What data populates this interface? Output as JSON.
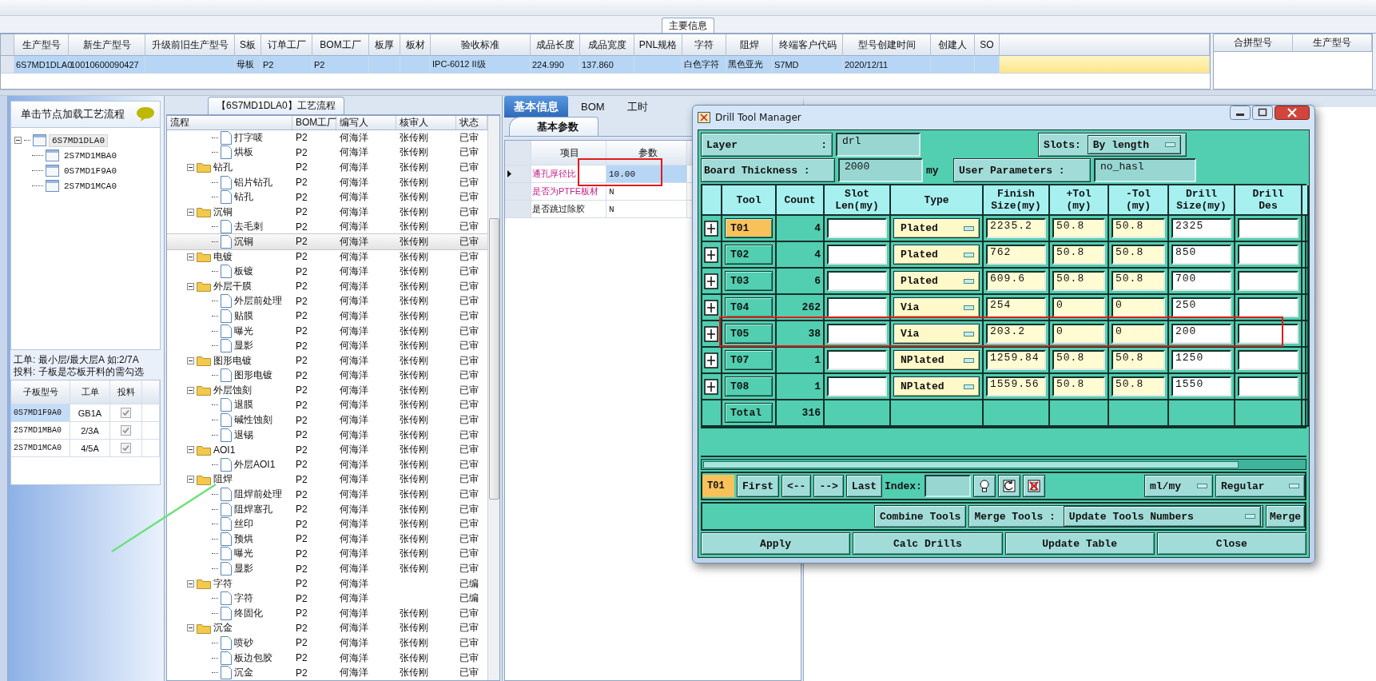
{
  "main_info": {
    "title": "主要信息",
    "columns": [
      "生产型号",
      "新生产型号",
      "升级前旧生产型号",
      "S板",
      "订单工厂",
      "BOM工厂",
      "板厚",
      "板材",
      "验收标准",
      "成品长度",
      "成品宽度",
      "PNL规格",
      "字符",
      "阻焊",
      "终端客户代码",
      "型号创建时间",
      "创建人",
      "SO"
    ],
    "rows": [
      {
        "selected": true,
        "cells": [
          "6S7MD1DLA0",
          "10010600090427",
          "",
          "母板",
          "P2",
          "P2",
          "",
          "",
          "IPC-6012 II级",
          "224.990",
          "137.860",
          "",
          "白色字符",
          "黑色亚光",
          "S7MD",
          "2020/12/11",
          "",
          ""
        ]
      }
    ]
  },
  "merge_table": {
    "columns": [
      "合拼型号",
      "生产型号"
    ]
  },
  "node_panel": {
    "title": "单击节点加载工艺流程",
    "tree": [
      {
        "label": "6S7MD1DLA0",
        "selected": true,
        "expanded": true,
        "children": [
          {
            "label": "2S7MD1MBA0",
            "selected": false
          },
          {
            "label": "0S7MD1F9A0",
            "selected": false
          },
          {
            "label": "2S7MD1MCA0",
            "selected": false
          }
        ]
      }
    ],
    "notes": [
      "工单: 最小层/最大层A 如:2/7A",
      "投料: 子板是芯板开料的需勾选"
    ],
    "sub_boards": {
      "columns": [
        "子板型号",
        "工单",
        "投料"
      ],
      "rows": [
        {
          "model": "0S7MD1F9A0",
          "order": "GB1A",
          "checked": true,
          "selected": true
        },
        {
          "model": "2S7MD1MBA0",
          "order": "2/3A",
          "checked": true,
          "selected": false
        },
        {
          "model": "2S7MD1MCA0",
          "order": "4/5A",
          "checked": true,
          "selected": false
        }
      ]
    }
  },
  "process_flow": {
    "title": "【6S7MD1DLA0】工艺流程",
    "columns": [
      "流程",
      "BOM工厂",
      "编写人",
      "核审人",
      "状态"
    ],
    "steps": [
      {
        "children": [
          {
            "name": "打字唛",
            "bom": "P2",
            "author": "何海洋",
            "reviewer": "张传刚",
            "status": "已审",
            "selected": false
          },
          {
            "name": "烘板",
            "bom": "P2",
            "author": "何海洋",
            "reviewer": "张传刚",
            "status": "已审",
            "selected": false
          }
        ]
      },
      {
        "name": "钻孔",
        "bom": "P2",
        "author": "何海洋",
        "reviewer": "张传刚",
        "status": "已审",
        "selected": false,
        "expanded": true,
        "children": [
          {
            "name": "铝片钻孔",
            "bom": "P2",
            "author": "何海洋",
            "reviewer": "张传刚",
            "status": "已审",
            "selected": false
          },
          {
            "name": "钻孔",
            "bom": "P2",
            "author": "何海洋",
            "reviewer": "张传刚",
            "status": "已审",
            "selected": false
          }
        ]
      },
      {
        "name": "沉铜",
        "bom": "P2",
        "author": "何海洋",
        "reviewer": "张传刚",
        "status": "已审",
        "selected": false,
        "expanded": true,
        "children": [
          {
            "name": "去毛刺",
            "bom": "P2",
            "author": "何海洋",
            "reviewer": "张传刚",
            "status": "已审",
            "selected": false
          },
          {
            "name": "沉铜",
            "bom": "P2",
            "author": "何海洋",
            "reviewer": "张传刚",
            "status": "已审",
            "selected": true
          }
        ]
      },
      {
        "name": "电镀",
        "bom": "P2",
        "author": "何海洋",
        "reviewer": "张传刚",
        "status": "已审",
        "selected": false,
        "expanded": true,
        "children": [
          {
            "name": "板镀",
            "bom": "P2",
            "author": "何海洋",
            "reviewer": "张传刚",
            "status": "已审",
            "selected": false
          }
        ]
      },
      {
        "name": "外层干膜",
        "bom": "P2",
        "author": "何海洋",
        "reviewer": "张传刚",
        "status": "已审",
        "selected": false,
        "expanded": true,
        "children": [
          {
            "name": "外层前处理",
            "bom": "P2",
            "author": "何海洋",
            "reviewer": "张传刚",
            "status": "已审",
            "selected": false
          },
          {
            "name": "贴膜",
            "bom": "P2",
            "author": "何海洋",
            "reviewer": "张传刚",
            "status": "已审",
            "selected": false
          },
          {
            "name": "曝光",
            "bom": "P2",
            "author": "何海洋",
            "reviewer": "张传刚",
            "status": "已审",
            "selected": false
          },
          {
            "name": "显影",
            "bom": "P2",
            "author": "何海洋",
            "reviewer": "张传刚",
            "status": "已审",
            "selected": false
          }
        ]
      },
      {
        "name": "图形电镀",
        "bom": "P2",
        "author": "何海洋",
        "reviewer": "张传刚",
        "status": "已审",
        "selected": false,
        "expanded": true,
        "children": [
          {
            "name": "图形电镀",
            "bom": "P2",
            "author": "何海洋",
            "reviewer": "张传刚",
            "status": "已审",
            "selected": false
          }
        ]
      },
      {
        "name": "外层蚀刻",
        "bom": "P2",
        "author": "何海洋",
        "reviewer": "张传刚",
        "status": "已审",
        "selected": false,
        "expanded": true,
        "children": [
          {
            "name": "退膜",
            "bom": "P2",
            "author": "何海洋",
            "reviewer": "张传刚",
            "status": "已审",
            "selected": false
          },
          {
            "name": "碱性蚀刻",
            "bom": "P2",
            "author": "何海洋",
            "reviewer": "张传刚",
            "status": "已审",
            "selected": false
          },
          {
            "name": "退锡",
            "bom": "P2",
            "author": "何海洋",
            "reviewer": "张传刚",
            "status": "已审",
            "selected": false
          }
        ]
      },
      {
        "name": "AOI1",
        "bom": "P2",
        "author": "何海洋",
        "reviewer": "张传刚",
        "status": "已审",
        "selected": false,
        "expanded": true,
        "children": [
          {
            "name": "外层AOI1",
            "bom": "P2",
            "author": "何海洋",
            "reviewer": "张传刚",
            "status": "已审",
            "selected": false
          }
        ]
      },
      {
        "name": "阻焊",
        "bom": "P2",
        "author": "何海洋",
        "reviewer": "张传刚",
        "status": "已审",
        "selected": false,
        "expanded": true,
        "children": [
          {
            "name": "阻焊前处理",
            "bom": "P2",
            "author": "何海洋",
            "reviewer": "张传刚",
            "status": "已审",
            "selected": false
          },
          {
            "name": "阻焊塞孔",
            "bom": "P2",
            "author": "何海洋",
            "reviewer": "张传刚",
            "status": "已审",
            "selected": false
          },
          {
            "name": "丝印",
            "bom": "P2",
            "author": "何海洋",
            "reviewer": "张传刚",
            "status": "已审",
            "selected": false
          },
          {
            "name": "预烘",
            "bom": "P2",
            "author": "何海洋",
            "reviewer": "张传刚",
            "status": "已审",
            "selected": false
          },
          {
            "name": "曝光",
            "bom": "P2",
            "author": "何海洋",
            "reviewer": "张传刚",
            "status": "已审",
            "selected": false
          },
          {
            "name": "显影",
            "bom": "P2",
            "author": "何海洋",
            "reviewer": "张传刚",
            "status": "已审",
            "selected": false
          }
        ]
      },
      {
        "name": "字符",
        "bom": "P2",
        "author": "何海洋",
        "status": "已编",
        "selected": false,
        "expanded": true,
        "children": [
          {
            "name": "字符",
            "bom": "P2",
            "author": "何海洋",
            "status": "已编",
            "selected": false
          },
          {
            "name": "终固化",
            "bom": "P2",
            "author": "何海洋",
            "reviewer": "张传刚",
            "status": "已审",
            "selected": false
          }
        ]
      },
      {
        "name": "沉金",
        "bom": "P2",
        "author": "何海洋",
        "reviewer": "张传刚",
        "status": "已审",
        "selected": false,
        "expanded": true,
        "children": [
          {
            "name": "喷砂",
            "bom": "P2",
            "author": "何海洋",
            "reviewer": "张传刚",
            "status": "已审",
            "selected": false
          },
          {
            "name": "板边包胶",
            "bom": "P2",
            "author": "何海洋",
            "reviewer": "张传刚",
            "status": "已审",
            "selected": false
          },
          {
            "name": "沉金",
            "bom": "P2",
            "author": "何海洋",
            "reviewer": "张传刚",
            "status": "已审",
            "selected": false
          }
        ]
      }
    ]
  },
  "basic_info": {
    "tabs": [
      {
        "label": "基本信息",
        "selected": true
      },
      {
        "label": "BOM",
        "selected": false
      },
      {
        "label": "工时",
        "selected": false
      }
    ],
    "subtab": "基本参数",
    "columns": [
      "项目",
      "参数"
    ],
    "rows": [
      {
        "item": "通孔厚径比",
        "value": "10.00",
        "highlighted": true,
        "selected": true
      },
      {
        "item": "是否为PTFE板材",
        "value": "N",
        "highlighted": true,
        "selected": false
      },
      {
        "item": "是否跳过除胶",
        "value": "N",
        "highlighted": false,
        "selected": false
      }
    ]
  },
  "drill_tool_manager": {
    "title": "Drill Tool Manager",
    "layer": {
      "label": "Layer",
      "colon": ":",
      "value": "drl"
    },
    "slots": {
      "label": "Slots:",
      "value": "By length"
    },
    "board_thickness": {
      "label": "Board Thickness :",
      "value": "2000",
      "unit": "my"
    },
    "user_parameters": {
      "label": "User Parameters :",
      "value": "no_hasl"
    },
    "columns": [
      "Tool",
      "Count",
      "Slot\nLen(my)",
      "Type",
      "Finish\nSize(my)",
      "+Tol\n(my)",
      "-Tol\n(my)",
      "Drill\nSize(my)",
      "Drill\nDes"
    ],
    "tools": [
      {
        "tool": "T01",
        "count": "4",
        "type": "Plated",
        "finish": "2235.2",
        "plus_tol": "50.8",
        "minus_tol": "50.8",
        "drill": "2325",
        "selected": true
      },
      {
        "tool": "T02",
        "count": "4",
        "type": "Plated",
        "finish": "762",
        "plus_tol": "50.8",
        "minus_tol": "50.8",
        "drill": "850",
        "selected": false
      },
      {
        "tool": "T03",
        "count": "6",
        "type": "Plated",
        "finish": "609.6",
        "plus_tol": "50.8",
        "minus_tol": "50.8",
        "drill": "700",
        "selected": false
      },
      {
        "tool": "T04",
        "count": "262",
        "type": "Via",
        "finish": "254",
        "plus_tol": "0",
        "minus_tol": "0",
        "drill": "250",
        "selected": false
      },
      {
        "tool": "T05",
        "count": "38",
        "type": "Via",
        "finish": "203.2",
        "plus_tol": "0",
        "minus_tol": "0",
        "drill": "200",
        "selected": false
      },
      {
        "tool": "T07",
        "count": "1",
        "type": "NPlated",
        "finish": "1259.84",
        "plus_tol": "50.8",
        "minus_tol": "50.8",
        "drill": "1250",
        "selected": false
      },
      {
        "tool": "T08",
        "count": "1",
        "type": "NPlated",
        "finish": "1559.56",
        "plus_tol": "50.8",
        "minus_tol": "50.8",
        "drill": "1550",
        "selected": false
      }
    ],
    "total": {
      "label": "Total",
      "count": "316"
    },
    "current_tool": "T01",
    "nav": [
      "First",
      "<--",
      "-->",
      "Last"
    ],
    "index_label": "Index:",
    "units": "ml/my",
    "mode": "Regular",
    "combine": "Combine Tools",
    "merge_label": "Merge Tools :",
    "merge_mode": "Update Tools Numbers",
    "merge": "Merge",
    "actions": [
      "Apply",
      "Calc Drills",
      "Update Table",
      "Close"
    ]
  }
}
